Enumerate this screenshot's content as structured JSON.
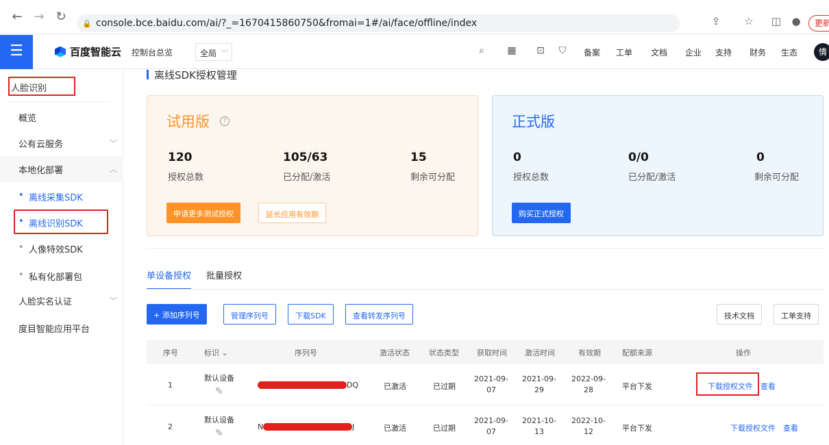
{
  "browser": {
    "url": "console.bce.baidu.com/ai/?_=1670415860750&fromai=1#/ai/face/offline/index",
    "update_label": "更新"
  },
  "header": {
    "logo": "百度智能云",
    "overview": "控制台总览",
    "region": "全局",
    "nav": [
      "备案",
      "工单",
      "文档",
      "企业",
      "支持",
      "财务",
      "生态"
    ],
    "avatar": "情"
  },
  "sidebar": {
    "title": "人脸识别",
    "items": [
      {
        "label": "概览"
      },
      {
        "label": "公有云服务",
        "arrow": "﹀"
      },
      {
        "label": "本地化部署",
        "arrow": "︿"
      },
      {
        "label": "离线采集SDK"
      },
      {
        "label": "离线识别SDK"
      },
      {
        "label": "人像特效SDK"
      },
      {
        "label": "私有化部署包"
      },
      {
        "label": "人脸实名认证",
        "arrow": "﹀"
      },
      {
        "label": "度目智能应用平台"
      }
    ]
  },
  "main": {
    "page_title": "离线SDK授权管理",
    "trial": {
      "title": "试用版",
      "help": "?",
      "stats": [
        {
          "value": "120",
          "label": "授权总数"
        },
        {
          "value": "105/63",
          "label": "已分配/激活"
        },
        {
          "value": "15",
          "label": "剩余可分配"
        }
      ],
      "buttons": [
        "申请更多测试授权",
        "延长应用有效期"
      ]
    },
    "formal": {
      "title": "正式版",
      "stats": [
        {
          "value": "0",
          "label": "授权总数"
        },
        {
          "value": "0/0",
          "label": "已分配/激活"
        },
        {
          "value": "0",
          "label": "剩余可分配"
        }
      ],
      "button": "购买正式授权"
    },
    "tabs": [
      "单设备授权",
      "批量授权"
    ],
    "toolbar": [
      "+ 添加序列号",
      "管理序列号",
      "下载SDK",
      "查看转发序列号",
      "技术文档",
      "工单支持"
    ],
    "table": {
      "headers": [
        "序号",
        "标识",
        "序列号",
        "激活状态",
        "状态类型",
        "获取时间",
        "激活时间",
        "有效期",
        "配额来源",
        "操作"
      ],
      "rows": [
        {
          "no": "1",
          "label": "默认设备",
          "serial_tail": "DQ",
          "active": "已激活",
          "status": "已过期",
          "get_a": "2021-09-",
          "get_b": "07",
          "act_a": "2021-09-",
          "act_b": "29",
          "exp_a": "2022-09-",
          "exp_b": "28",
          "source": "平台下发",
          "op1": "下载授权文件",
          "op2": "查看"
        },
        {
          "no": "2",
          "label": "默认设备",
          "serial_tail": "J",
          "serial_head": "N",
          "active": "已激活",
          "status": "已过期",
          "get_a": "2021-09-",
          "get_b": "07",
          "act_a": "2021-10-",
          "act_b": "13",
          "exp_a": "2022-10-",
          "exp_b": "12",
          "source": "平台下发",
          "op1": "下载授权文件",
          "op2": "查看"
        }
      ]
    }
  },
  "colors": {
    "primary": "#2468f2",
    "trial_orange": "#ff9326",
    "highlight_red": "#e02020"
  }
}
